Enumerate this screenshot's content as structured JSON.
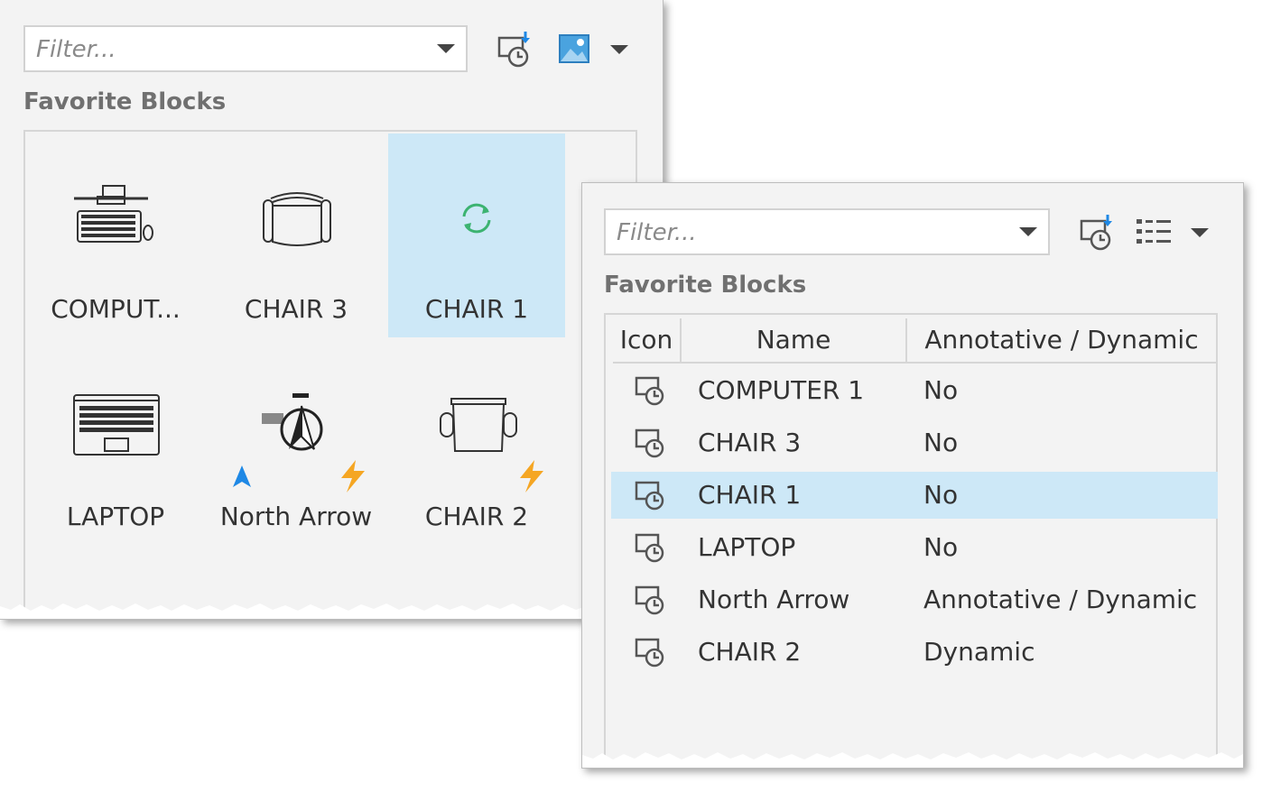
{
  "left_panel": {
    "filter": {
      "placeholder": "Filter..."
    },
    "section_title": "Favorite Blocks",
    "tiles": [
      {
        "label": "COMPUT...",
        "icon": "computer-block-icon"
      },
      {
        "label": "CHAIR 3",
        "icon": "chair-block-icon"
      },
      {
        "label": "CHAIR 1",
        "icon": "loading-sync-icon",
        "selected": true
      },
      {
        "label": "LAPTOP",
        "icon": "laptop-block-icon"
      },
      {
        "label": "North Arrow",
        "icon": "north-arrow-block-icon",
        "badges": [
          "annotative-icon",
          "dynamic-lightning-icon"
        ]
      },
      {
        "label": "CHAIR 2",
        "icon": "chair-2-block-icon",
        "badges": [
          "dynamic-lightning-icon"
        ]
      }
    ]
  },
  "right_panel": {
    "filter": {
      "placeholder": "Filter..."
    },
    "section_title": "Favorite Blocks",
    "columns": [
      "Icon",
      "Name",
      "Annotative / Dynamic"
    ],
    "rows": [
      {
        "name": "COMPUTER 1",
        "annot": "No"
      },
      {
        "name": "CHAIR 3",
        "annot": "No"
      },
      {
        "name": "CHAIR 1",
        "annot": "No",
        "selected": true
      },
      {
        "name": "LAPTOP",
        "annot": "No"
      },
      {
        "name": "North Arrow",
        "annot": "Annotative / Dynamic"
      },
      {
        "name": "CHAIR 2",
        "annot": "Dynamic"
      }
    ]
  },
  "colors": {
    "selection": "#cde8f7",
    "accent_blue": "#1e88e5",
    "sync_green": "#3cb371",
    "lightning": "#f5a623"
  }
}
